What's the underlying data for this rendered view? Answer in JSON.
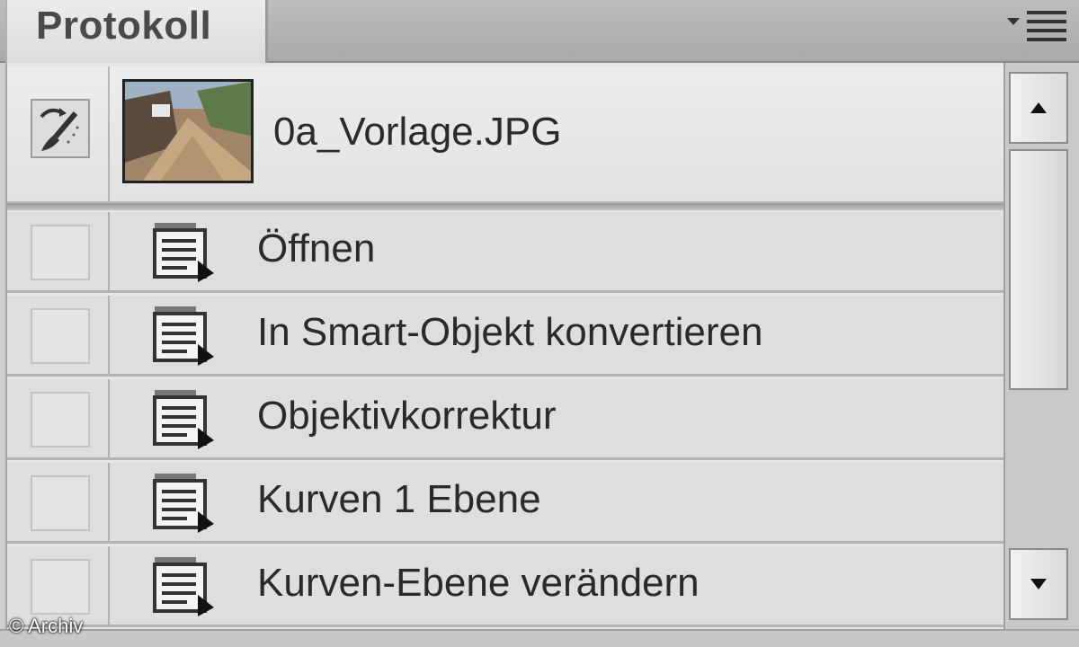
{
  "panel": {
    "tab_title": "Protokoll",
    "menu_icon": "panel-menu-icon"
  },
  "snapshot": {
    "label": "0a_Vorlage.JPG",
    "source_icon": "history-brush-icon"
  },
  "steps": [
    {
      "label": "Öffnen"
    },
    {
      "label": "In Smart-Objekt konvertieren"
    },
    {
      "label": "Objektivkorrektur"
    },
    {
      "label": "Kurven 1 Ebene"
    },
    {
      "label": "Kurven-Ebene verändern"
    }
  ],
  "credit": "© Archiv",
  "colors": {
    "panel_bg": "#e6e6e6",
    "tab_bg": "#e4e4e4",
    "text": "#2a2a2a"
  }
}
